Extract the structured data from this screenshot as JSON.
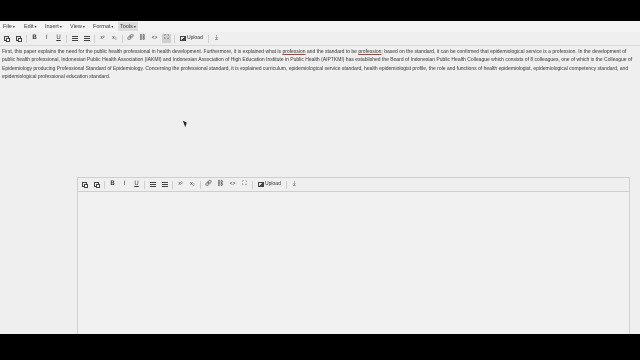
{
  "menubar": {
    "items": [
      {
        "label": "File"
      },
      {
        "label": "Edit"
      },
      {
        "label": "Insert"
      },
      {
        "label": "View"
      },
      {
        "label": "Format"
      },
      {
        "label": "Tools"
      }
    ]
  },
  "toolbar": {
    "bold": "B",
    "italic": "I",
    "underline": "U",
    "superscript": "x²",
    "subscript": "x₂",
    "code": "<>",
    "upload_label": "Upload"
  },
  "editor2_toolbar": {
    "bold": "B",
    "italic": "I",
    "underline": "U",
    "superscript": "x²",
    "subscript": "x₂",
    "code": "<>",
    "upload_label": "Upload"
  },
  "content": {
    "part1": "First, this paper explains the need for the public health professional in health development. Furthermore, it is explained what is ",
    "word1": "profession",
    "part2": " and the standard to be ",
    "word2": "profession",
    "part3": "; based on the standard, it can be confirmed that epidemiological service is a profession. In the development of public health professional, Indonesian Public Health Association (IAKMI) and Indonesian Association of High Education Institute in Public Health (AIPTKMI) has established the Board of Indonesian Public Health Colleague which consists of 8 colleagues, one of which is the Colleague of Epidemiology producing Professional Standard of Epidemiology. Concerning the professional standard, it is explained curriculum, epidemiological service standard, health epidemiologist profile, the role and functions of health epidemiologist, epidemiological competency standard, and epidemiological professional education standard."
  }
}
